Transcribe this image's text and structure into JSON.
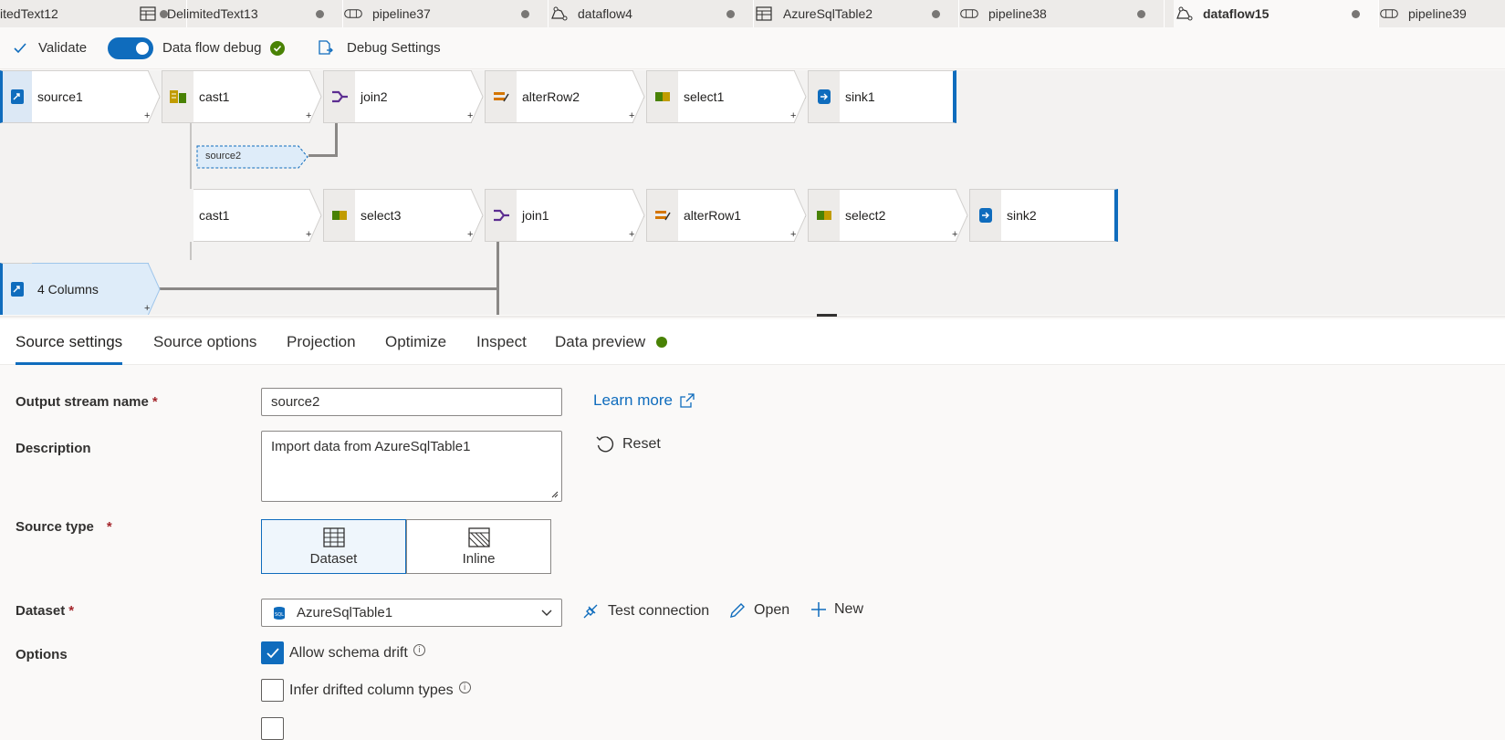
{
  "tabs": [
    {
      "label": "itedText12",
      "icon": "table-icon"
    },
    {
      "label": "DelimitedText13",
      "icon": "table-icon"
    },
    {
      "label": "pipeline37",
      "icon": "pipeline-icon"
    },
    {
      "label": "dataflow4",
      "icon": "dataflow-icon"
    },
    {
      "label": "AzureSqlTable2",
      "icon": "table-icon"
    },
    {
      "label": "pipeline38",
      "icon": "pipeline-icon"
    },
    {
      "label": "dataflow15",
      "icon": "dataflow-icon",
      "active": true
    },
    {
      "label": "pipeline39",
      "icon": "pipeline-icon"
    }
  ],
  "toolbar": {
    "validate": "Validate",
    "debug_label": "Data flow debug",
    "debug_on": true,
    "debug_settings": "Debug Settings"
  },
  "canvas": {
    "row1": [
      "source1",
      "cast1",
      "join2",
      "alterRow2",
      "select1",
      "sink1"
    ],
    "row2": [
      "cast1",
      "select3",
      "join1",
      "alterRow1",
      "select2",
      "sink2"
    ],
    "ghost": "source2",
    "selected_node": "4 Columns"
  },
  "panel": {
    "tabs": [
      "Source settings",
      "Source options",
      "Projection",
      "Optimize",
      "Inspect",
      "Data preview"
    ],
    "active_tab": "Source settings"
  },
  "form": {
    "output_stream_label": "Output stream name",
    "output_stream_value": "source2",
    "description_label": "Description",
    "description_value": "Import data from AzureSqlTable1",
    "learn_more": "Learn more",
    "reset": "Reset",
    "source_type_label": "Source type",
    "source_type_options": [
      "Dataset",
      "Inline"
    ],
    "source_type_selected": "Dataset",
    "dataset_label": "Dataset",
    "dataset_value": "AzureSqlTable1",
    "test_connection": "Test connection",
    "open": "Open",
    "new": "New",
    "options_label": "Options",
    "allow_schema_drift": "Allow schema drift",
    "allow_schema_drift_checked": true,
    "infer_drifted": "Infer drifted column types",
    "infer_drifted_checked": false
  },
  "colors": {
    "accent": "#0f6cbd",
    "success": "#498205",
    "required": "#a4262c"
  }
}
